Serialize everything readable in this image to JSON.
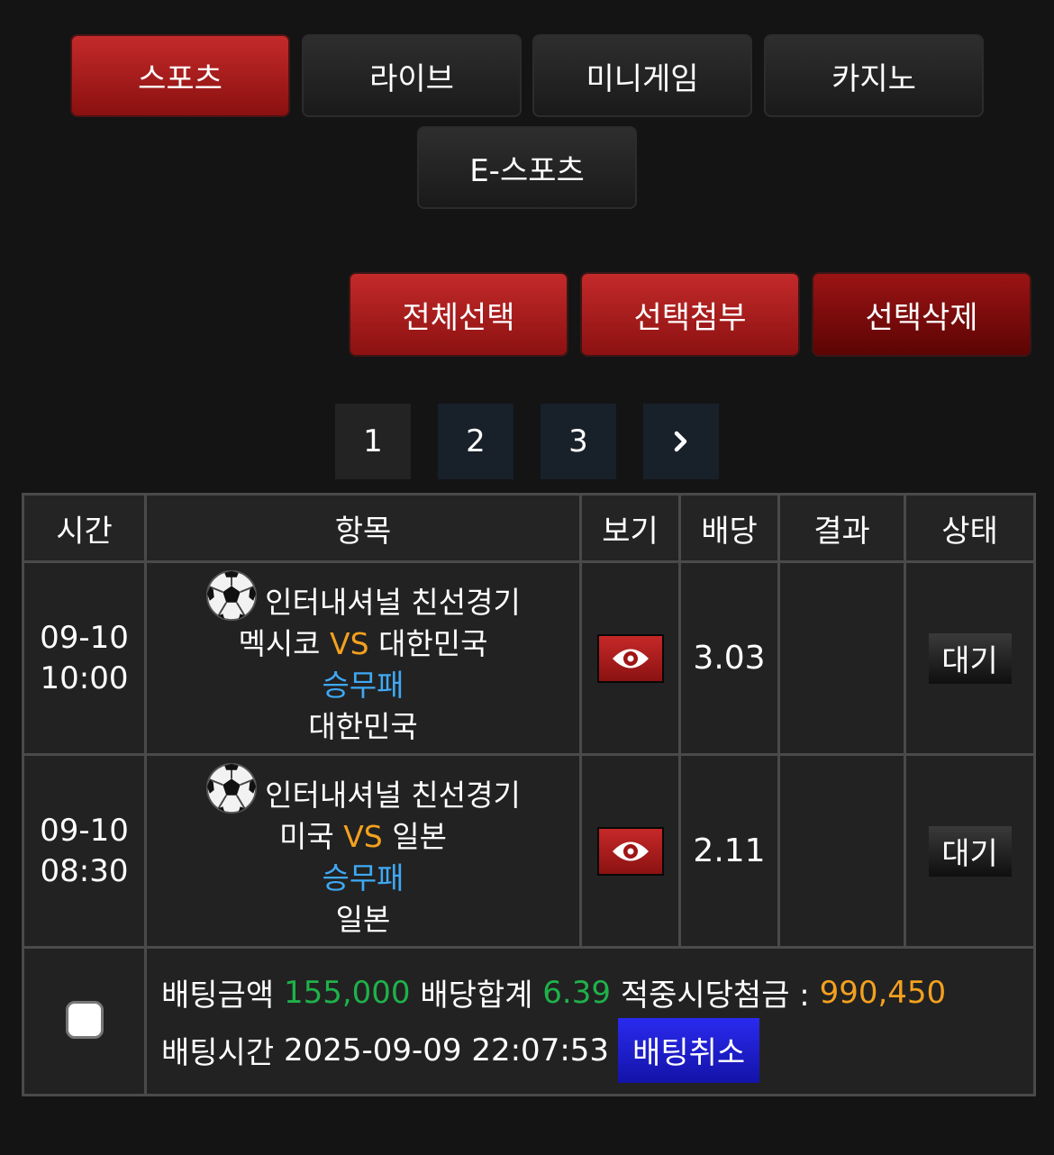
{
  "tabs": [
    {
      "label": "스포츠",
      "active": true
    },
    {
      "label": "라이브",
      "active": false
    },
    {
      "label": "미니게임",
      "active": false
    },
    {
      "label": "카지노",
      "active": false
    },
    {
      "label": "E-스포츠",
      "active": false
    }
  ],
  "actions": {
    "select_all": "전체선택",
    "attach_selected": "선택첨부",
    "delete_selected": "선택삭제"
  },
  "pagination": {
    "pages": [
      "1",
      "2",
      "3"
    ],
    "current": "1",
    "next_icon": "chevron-right-icon"
  },
  "table": {
    "headers": {
      "time": "시간",
      "item": "항목",
      "view": "보기",
      "odds": "배당",
      "result": "결과",
      "status": "상태"
    },
    "rows": [
      {
        "date": "09-10",
        "time": "10:00",
        "league": "인터내셔널 친선경기",
        "home": "멕시코",
        "vs": "VS",
        "away": "대한민국",
        "market": "승무패",
        "pick": "대한민국",
        "odds": "3.03",
        "result": "",
        "status": "대기",
        "sport_icon": "soccer-ball-icon"
      },
      {
        "date": "09-10",
        "time": "08:30",
        "league": "인터내셔널 친선경기",
        "home": "미국",
        "vs": "VS",
        "away": "일본",
        "market": "승무패",
        "pick": "일본",
        "odds": "2.11",
        "result": "",
        "status": "대기",
        "sport_icon": "soccer-ball-icon"
      }
    ]
  },
  "summary": {
    "bet_amount_label": "배팅금액",
    "bet_amount": "155,000",
    "total_odds_label": "배당합계",
    "total_odds": "6.39",
    "payout_label": "적중시당첨금 :",
    "payout": "990,450",
    "bet_time_label": "배팅시간",
    "bet_time": "2025-09-09 22:07:53",
    "cancel_label": "배팅취소"
  },
  "colors": {
    "accent_red": "#b81e1e",
    "odds_green": "#1fb14a",
    "vs_orange": "#f3a11f",
    "market_blue": "#3fa9f5",
    "cancel_blue": "#1a1ad0"
  }
}
